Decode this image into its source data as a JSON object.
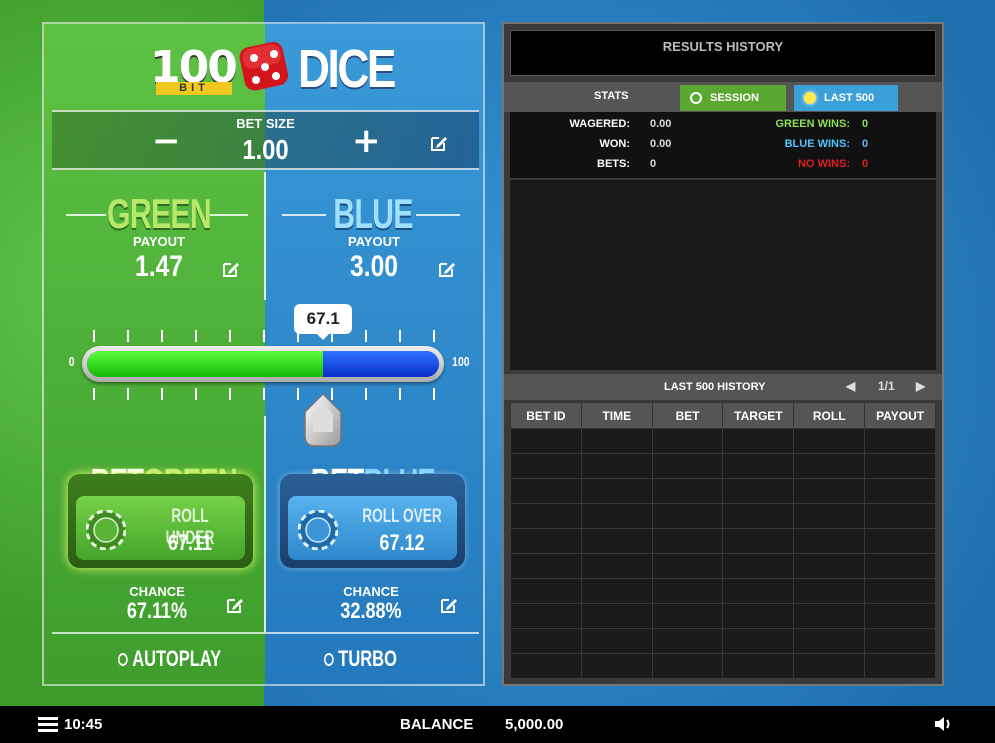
{
  "logo": {
    "number": "100",
    "bit": "BIT",
    "word": "DICE"
  },
  "bet_size": {
    "label": "BET SIZE",
    "value": "1.00",
    "minus": "−",
    "plus": "+"
  },
  "green": {
    "title": "GREEN",
    "payout_label": "PAYOUT",
    "payout": "1.47",
    "chance_label": "CHANCE",
    "chance": "67.11%",
    "bet_title_a": "BET",
    "bet_title_b": "GREEN",
    "roll_label": "ROLL UNDER",
    "roll_value": "67.11",
    "color": "#5ec244"
  },
  "blue": {
    "title": "BLUE",
    "payout_label": "PAYOUT",
    "payout": "3.00",
    "chance_label": "CHANCE",
    "chance": "32.88%",
    "bet_title_a": "BET",
    "bet_title_b": "BLUE",
    "roll_label": "ROLL OVER",
    "roll_value": "67.12",
    "color": "#2f86c8"
  },
  "slider": {
    "min_label": "0",
    "max_label": "100",
    "value": 67.1,
    "value_label": "67.1"
  },
  "toggles": {
    "autoplay": "AUTOPLAY",
    "turbo": "TURBO"
  },
  "results": {
    "title": "RESULTS HISTORY",
    "stats_label": "STATS",
    "tabs": {
      "session": "SESSION",
      "last500": "LAST 500"
    },
    "wagered_label": "WAGERED:",
    "wagered": "0.00",
    "won_label": "WON:",
    "won": "0.00",
    "bets_label": "BETS:",
    "bets": "0",
    "green_wins_label": "GREEN WINS:",
    "green_wins": "0",
    "blue_wins_label": "BLUE WINS:",
    "blue_wins": "0",
    "no_wins_label": "NO WINS:",
    "no_wins": "0",
    "history_title": "LAST 500 HISTORY",
    "page": "1/1",
    "columns": [
      "BET ID",
      "TIME",
      "BET",
      "TARGET",
      "ROLL",
      "PAYOUT"
    ],
    "colors": {
      "green_wins": "#8be05a",
      "blue_wins": "#4fc4ff",
      "no_wins": "#e02020"
    }
  },
  "footer": {
    "time": "10:45",
    "balance_label": "BALANCE",
    "balance": "5,000.00"
  }
}
